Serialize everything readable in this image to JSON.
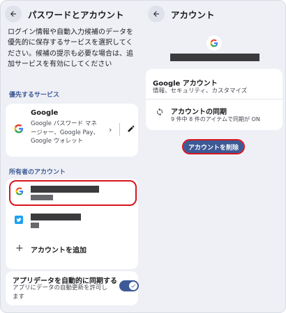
{
  "left_pane": {
    "title": "パスワードとアカウント",
    "description": "ログイン情報や自動入力候補のデータを優先的に保存するサービスを選択してください。候補の提示も必要な場合は、追加サービスを有効にしてください",
    "preferred_section": "優先するサービス",
    "service": {
      "name": "Google",
      "subtitle": "Google パスワード マネージャー、Google Pay、Google ウォレット",
      "icon": "google-icon"
    },
    "owner_section": "所有者のアカウント",
    "accounts": [
      {
        "icon": "google-icon",
        "highlighted": true
      },
      {
        "icon": "twitter-icon",
        "highlighted": false
      }
    ],
    "add_account_label": "アカウントを追加",
    "sync": {
      "title": "アプリデータを自動的に同期する",
      "subtitle": "アプリにデータの自動更新を許可します",
      "enabled": true
    }
  },
  "right_pane": {
    "title": "アカウント",
    "account_icon": "google-icon",
    "google_account_title": "Google アカウント",
    "google_account_subtitle": "情報、セキュリティ、カスタマイズ",
    "sync_title": "アカウントの同期",
    "sync_subtitle": "9 件中 8 件のアイテムで同期が ON",
    "remove_button_label": "アカウントを削除"
  },
  "colors": {
    "accent": "#3d5a96",
    "highlight": "#d7141c",
    "background": "#eef0f6"
  }
}
